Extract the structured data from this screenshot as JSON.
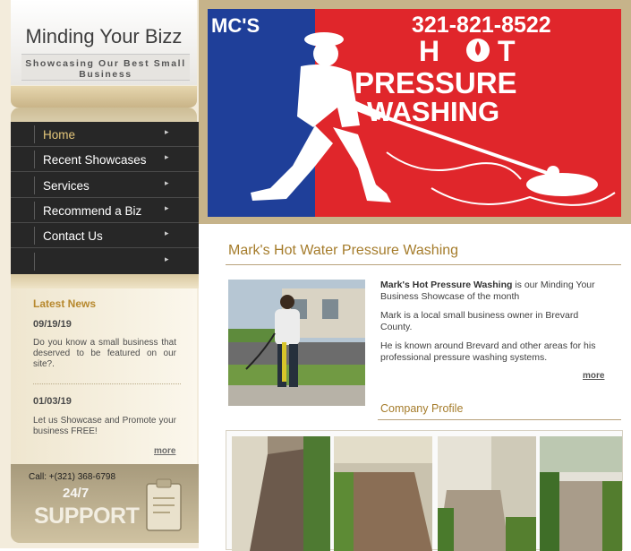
{
  "brand": {
    "title": "Minding Your Bizz",
    "tagline": "Showcasing Our Best Small Business"
  },
  "nav": {
    "items": [
      {
        "label": "Home",
        "active": true
      },
      {
        "label": "Recent Showcases"
      },
      {
        "label": "Services"
      },
      {
        "label": "Recommend a Biz"
      },
      {
        "label": "Contact Us"
      },
      {
        "label": ""
      }
    ],
    "arrow_icon": "chevron-right-icon"
  },
  "news": {
    "title": "Latest News",
    "items": [
      {
        "date": "09/19/19",
        "text": "Do you know a small business that deserved to be featured on our site?."
      },
      {
        "date": "01/03/19",
        "text": "Let us Showcase and Promote your business FREE!"
      }
    ],
    "more": "more"
  },
  "support": {
    "call": "Call: +(321) 368-6798",
    "hours": "24/7",
    "word": "SUPPORT",
    "icon": "clipboard-icon"
  },
  "banner": {
    "brand": "MC'S",
    "phone": "321-821-8522",
    "line1_a": "H",
    "line1_b": "T",
    "line2": "PRESSURE",
    "line3": "WASHING",
    "colors": {
      "red": "#e0262b",
      "blue": "#1f3f99"
    }
  },
  "content": {
    "heading": "Mark's Hot Water Pressure Washing",
    "intro_bold": "Mark's Hot Pressure Washing",
    "intro_rest": " is our Minding Your Business Showcase of the month",
    "p2": "Mark is a local small business owner in Brevard County.",
    "p3": "He is known around Brevard and other areas for his professional pressure washing systems.",
    "more": "more",
    "profile_heading": "Company Profile"
  },
  "colors": {
    "accent": "#a57c2b",
    "nav_bg": "#272727",
    "nav_active": "#e3c67a"
  }
}
